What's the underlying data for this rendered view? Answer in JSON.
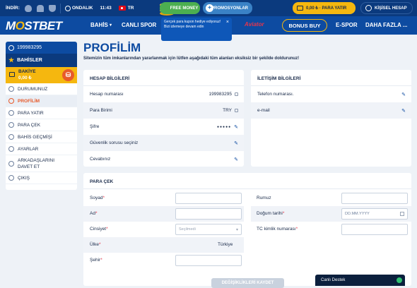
{
  "topbar": {
    "download_label": "İNDİR:",
    "odds_label": "ONDALIK",
    "time": "11:43",
    "lang": "TR",
    "free_money": "FREE MONEY",
    "promotions": "PROMOSYONLAR",
    "deposit": "0,00 ₺ · PARA YATIR",
    "account": "KİŞİSEL HESAP"
  },
  "nav": {
    "logo_pre": "M",
    "logo_o": "O",
    "logo_post": "STBET",
    "items": [
      "BAHİS",
      "CANLI SPOR",
      "E-SPOR",
      "DAHA FAZLA ..."
    ],
    "aviator": "Aviator",
    "bonus_buy": "BONUS BUY"
  },
  "tooltip": {
    "text": "Gerçek para kupon hediye ediyoruz! Bizi izlemeye devam edin",
    "close": "×"
  },
  "sidebar": {
    "account_id": "199983295",
    "bets": "BAHİSLER",
    "balance_label": "BAKİYE",
    "balance_value": "0,00 ₺",
    "items": [
      "DURUMUNUZ",
      "PROFİLİM",
      "PARA YATIR",
      "PARA ÇEK",
      "BAHİS GEÇMİŞİ",
      "AYARLAR",
      "ARKADAŞLARINI DAVET ET",
      "ÇIKIŞ"
    ],
    "active_item": "PROFİLİM"
  },
  "main": {
    "title": "PROFİLİM",
    "subtitle": "Sitemizin tüm imkanlarından yararlanmak için lütfen aşağıdaki tüm alanları eksiksiz bir şekilde doldurunuz!"
  },
  "account_info": {
    "header": "HESAP BİLGİLERİ",
    "rows": [
      {
        "label": "Hesap numarası",
        "value": "199983295"
      },
      {
        "label": "Para Birimi",
        "value": "TRY"
      },
      {
        "label": "Şifre",
        "value": "●●●●●"
      },
      {
        "label": "Güvenlik sorusu seçiniz",
        "value": ""
      },
      {
        "label": "Cevabınız",
        "value": ""
      }
    ]
  },
  "contact_info": {
    "header": "İLETİŞİM BİLGİLERİ",
    "rows": [
      {
        "label": "Telefon numarası."
      },
      {
        "label": "e-mail"
      }
    ]
  },
  "withdraw": {
    "header": "PARA ÇEK",
    "left_fields": [
      {
        "label": "Soyad",
        "required": "*",
        "value": ""
      },
      {
        "label": "Ad",
        "required": "*",
        "value": ""
      },
      {
        "label": "Cinsiyet",
        "required": "*",
        "value": "Seçilmedi"
      },
      {
        "label": "Ülke",
        "required": "*",
        "value": "Türkiye"
      },
      {
        "label": "Şehir",
        "required": "*",
        "value": ""
      }
    ],
    "right_fields": [
      {
        "label": "Rumuz",
        "required": "",
        "value": ""
      },
      {
        "label": "Doğum tarihi",
        "required": "*",
        "placeholder": "DD.MM.YYYY"
      },
      {
        "label": "TC kimlik numarası",
        "required": "*",
        "value": ""
      }
    ],
    "submit": "DEĞİŞİKLİKLERİ KAYDET"
  },
  "chat": {
    "label": "Canlı Destek"
  },
  "colors": {
    "primary": "#0d4ba1",
    "dark": "#0b3a7e",
    "accent": "#f5b70f",
    "active": "#e85a2a"
  }
}
